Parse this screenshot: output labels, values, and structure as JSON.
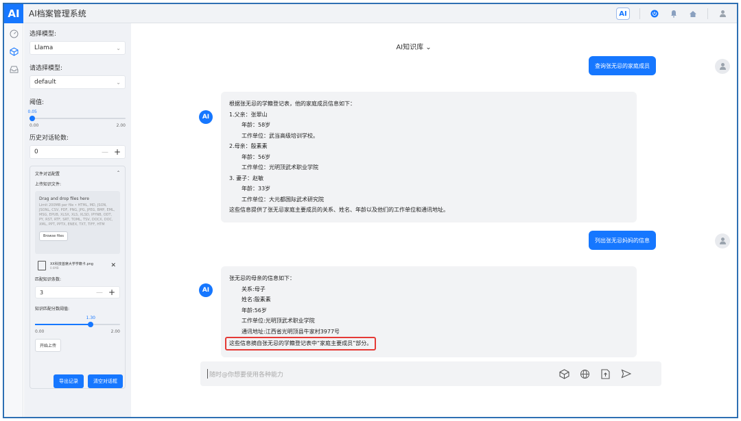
{
  "app": {
    "logo": "AI",
    "title": "AI档案管理系统"
  },
  "topbar": {
    "ai_badge": "AI",
    "icons": [
      "power-icon",
      "bell-icon",
      "home-icon",
      "user-icon"
    ]
  },
  "rail": {
    "icons": [
      "gauge-icon",
      "cube-icon",
      "inbox-icon"
    ]
  },
  "sidebar": {
    "model_label": "选择模型:",
    "model_value": "Llama",
    "model2_label": "请选择模型:",
    "model2_value": "default",
    "threshold": {
      "label": "阈值:",
      "value": "0.05",
      "min": "0.00",
      "max": "2.00",
      "fraction": 0.025
    },
    "history": {
      "label": "历史对话轮数:",
      "value": "0"
    },
    "file_panel": {
      "title": "文件对话配置",
      "upload_label": "上传知识文件:",
      "drop_title": "Drag and drop files here",
      "drop_limit": "Limit 200MB per file • HTML, MD, JSON, JSONL, CSV, PDF, PNG, JPG, JPEG, BMP, EML, MSG, EPUB, XLSX, XLS, XLSD, IPYNB, ODT, PY, RST, RTF, SRT, TOML, TSV, DOCX, DOC, XML, PPT, PPTX, ENEX, TXT, TIFF, HTM",
      "browse": "Browse files",
      "file_name": "XX科技首席大学学籍卡.png",
      "file_size": "0.6MB",
      "match_label": "匹配知识条数:",
      "match_value": "3",
      "score": {
        "label": "知识匹配分数阈值:",
        "value": "1.30",
        "min": "0.00",
        "max": "2.00",
        "fraction": 0.65
      },
      "upload_btn": "开始上传"
    },
    "export_btn": "导出记录",
    "clear_btn": "清空对话框"
  },
  "chat": {
    "kb_title": "AI知识库",
    "q1": "查询张无忌的家庭成员",
    "a1": {
      "intro": "根据张无忌的学籍登记表，他的家庭成员信息如下：",
      "father": "1.父亲：张翠山",
      "father_age": "年龄：58岁",
      "father_work": "工作单位：武当高级培训学校。",
      "mother": "2.母亲：殷素素",
      "mother_age": "年龄：56岁",
      "mother_work": "工作单位：光明顶武术职业学院",
      "wife": "3. 妻子：赵敏",
      "wife_age": "年龄：33岁",
      "wife_work": "工作单位：大元都国际武术研究院",
      "outro": "这些信息提供了张无忌家庭主要成员的关系、姓名、年龄以及他们的工作单位和通讯地址。"
    },
    "q2": "列出张无忌妈妈的信息",
    "a2": {
      "intro": "张无忌的母亲的信息如下：",
      "relation": "关系:母子",
      "name": "姓名:殷素素",
      "age": "年龄:56岁",
      "work": "工作单位:光明顶武术职业学院",
      "address": "通讯地址:江西省光明顶县牛家村3977号",
      "source": "这些信息摘自张无忌的学籍登记表中“家庭主要成员”部分。"
    },
    "ai_avatar": "AI",
    "input_placeholder": "随时@你想要使用各种能力"
  }
}
